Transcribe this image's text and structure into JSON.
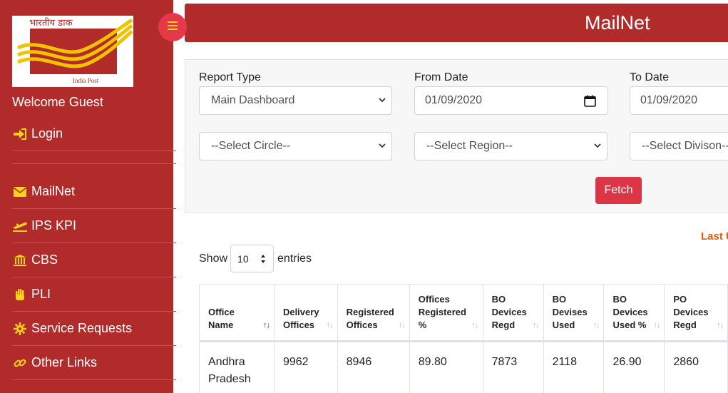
{
  "logo": {
    "hindi_text": "भारतीय डाक",
    "caption": "India Post"
  },
  "sidebar": {
    "welcome": "Welcome Guest",
    "login": "Login",
    "items": [
      {
        "label": "MailNet",
        "icon": "envelope-icon"
      },
      {
        "label": "IPS KPI",
        "icon": "plane-icon"
      },
      {
        "label": "CBS",
        "icon": "bank-icon"
      },
      {
        "label": "PLI",
        "icon": "hand-icon"
      },
      {
        "label": "Service Requests",
        "icon": "gear-icon"
      },
      {
        "label": "Other Links",
        "icon": "link-icon"
      }
    ]
  },
  "header": {
    "title": "MailNet"
  },
  "filters": {
    "report_type_label": "Report Type",
    "report_type_value": "Main Dashboard",
    "from_date_label": "From Date",
    "from_date_value": "01/09/2020",
    "to_date_label": "To Date",
    "to_date_value": "01/09/2020",
    "circle_value": "--Select Circle--",
    "region_value": "--Select Region--",
    "division_value": "--Select Divison--",
    "fetch_label": "Fetch"
  },
  "last_updated": "Last U",
  "entries": {
    "show_label": "Show",
    "value": "10",
    "suffix": "entries"
  },
  "table": {
    "headers": [
      [
        "Office",
        "Name"
      ],
      [
        "Delivery",
        "Offices"
      ],
      [
        "Registered",
        "Offices"
      ],
      [
        "Offices",
        "Registered",
        "%"
      ],
      [
        "BO",
        "Devices",
        "Regd"
      ],
      [
        "BO",
        "Devises",
        "Used"
      ],
      [
        "BO",
        "Devices",
        "Used %"
      ],
      [
        "PO",
        "Devices",
        "Regd"
      ]
    ],
    "rows": [
      [
        "Andhra Pradesh",
        "9962",
        "8946",
        "89.80",
        "7873",
        "2118",
        "26.90",
        "2860"
      ]
    ]
  },
  "colors": {
    "brand_red": "#b22b2b",
    "accent_red": "#dc3545",
    "icon_yellow": "#ffd21f",
    "last_updated_orange": "#e05a10"
  }
}
